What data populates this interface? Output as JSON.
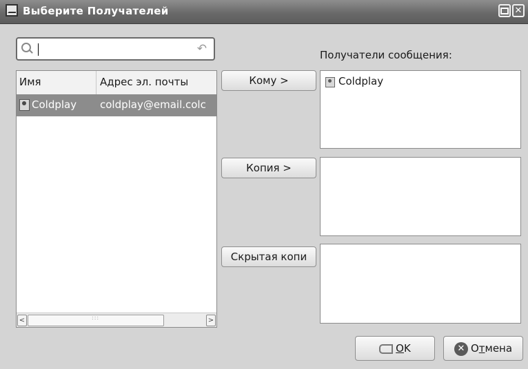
{
  "window": {
    "title": "Выберите Получателей"
  },
  "search": {
    "value": "",
    "clear_icon": "undo-arrow-icon"
  },
  "contacts": {
    "columns": [
      "Имя",
      "Адрес эл. почты"
    ],
    "rows": [
      {
        "name": "Coldplay",
        "email": "coldplay@email.colc",
        "selected": true
      }
    ]
  },
  "buttons": {
    "to": "Кому >",
    "cc": "Копия >",
    "bcc": "Скрытая копи"
  },
  "recipients": {
    "label": "Получатели сообщения:",
    "to": [
      "Coldplay"
    ],
    "cc": [],
    "bcc": []
  },
  "footer": {
    "ok_mnemonic": "O",
    "ok_rest": "K",
    "cancel_first": "O",
    "cancel_mnemonic": "т",
    "cancel_rest": "мена"
  },
  "colors": {
    "titlebar": "#6a6a6a",
    "selected_row": "#8c8c8c",
    "background": "#d4d4d4"
  }
}
